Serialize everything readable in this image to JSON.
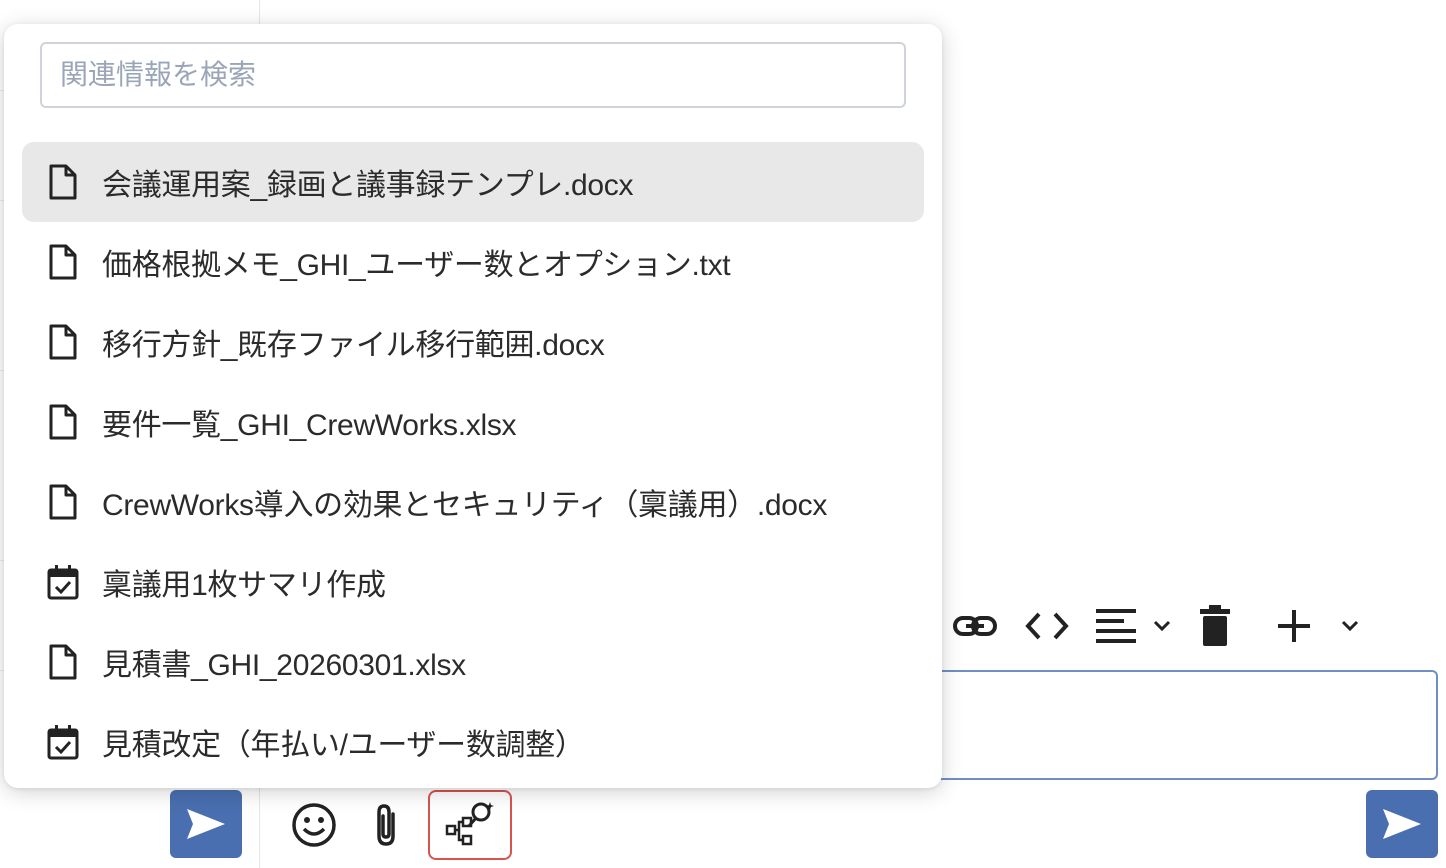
{
  "search": {
    "placeholder": "関連情報を検索",
    "value": ""
  },
  "results": [
    {
      "label": "会議運用案_録画と議事録テンプレ.docx",
      "icon": "document-icon",
      "active": true
    },
    {
      "label": "価格根拠メモ_GHI_ユーザー数とオプション.txt",
      "icon": "document-icon",
      "active": false
    },
    {
      "label": "移行方針_既存ファイル移行範囲.docx",
      "icon": "document-icon",
      "active": false
    },
    {
      "label": "要件一覧_GHI_CrewWorks.xlsx",
      "icon": "document-icon",
      "active": false
    },
    {
      "label": "CrewWorks導入の効果とセキュリティ（稟議用）.docx",
      "icon": "document-icon",
      "active": false
    },
    {
      "label": "稟議用1枚サマリ作成",
      "icon": "calendar-check-icon",
      "active": false
    },
    {
      "label": "見積書_GHI_20260301.xlsx",
      "icon": "document-icon",
      "active": false
    },
    {
      "label": "見積改定（年払い/ユーザー数調整）",
      "icon": "calendar-check-icon",
      "active": false
    }
  ],
  "toolbar": [
    "link-icon",
    "code-icon",
    "align-left-icon",
    "chevron-down-icon",
    "trash-icon",
    "plus-icon",
    "chevron-down-icon"
  ],
  "bottom_tools": [
    "emoji-icon",
    "paperclip-icon",
    "related-search-icon"
  ],
  "colors": {
    "send": "#4a6fb0",
    "highlight": "#d9534f",
    "active_row": "#e8e8e8"
  }
}
